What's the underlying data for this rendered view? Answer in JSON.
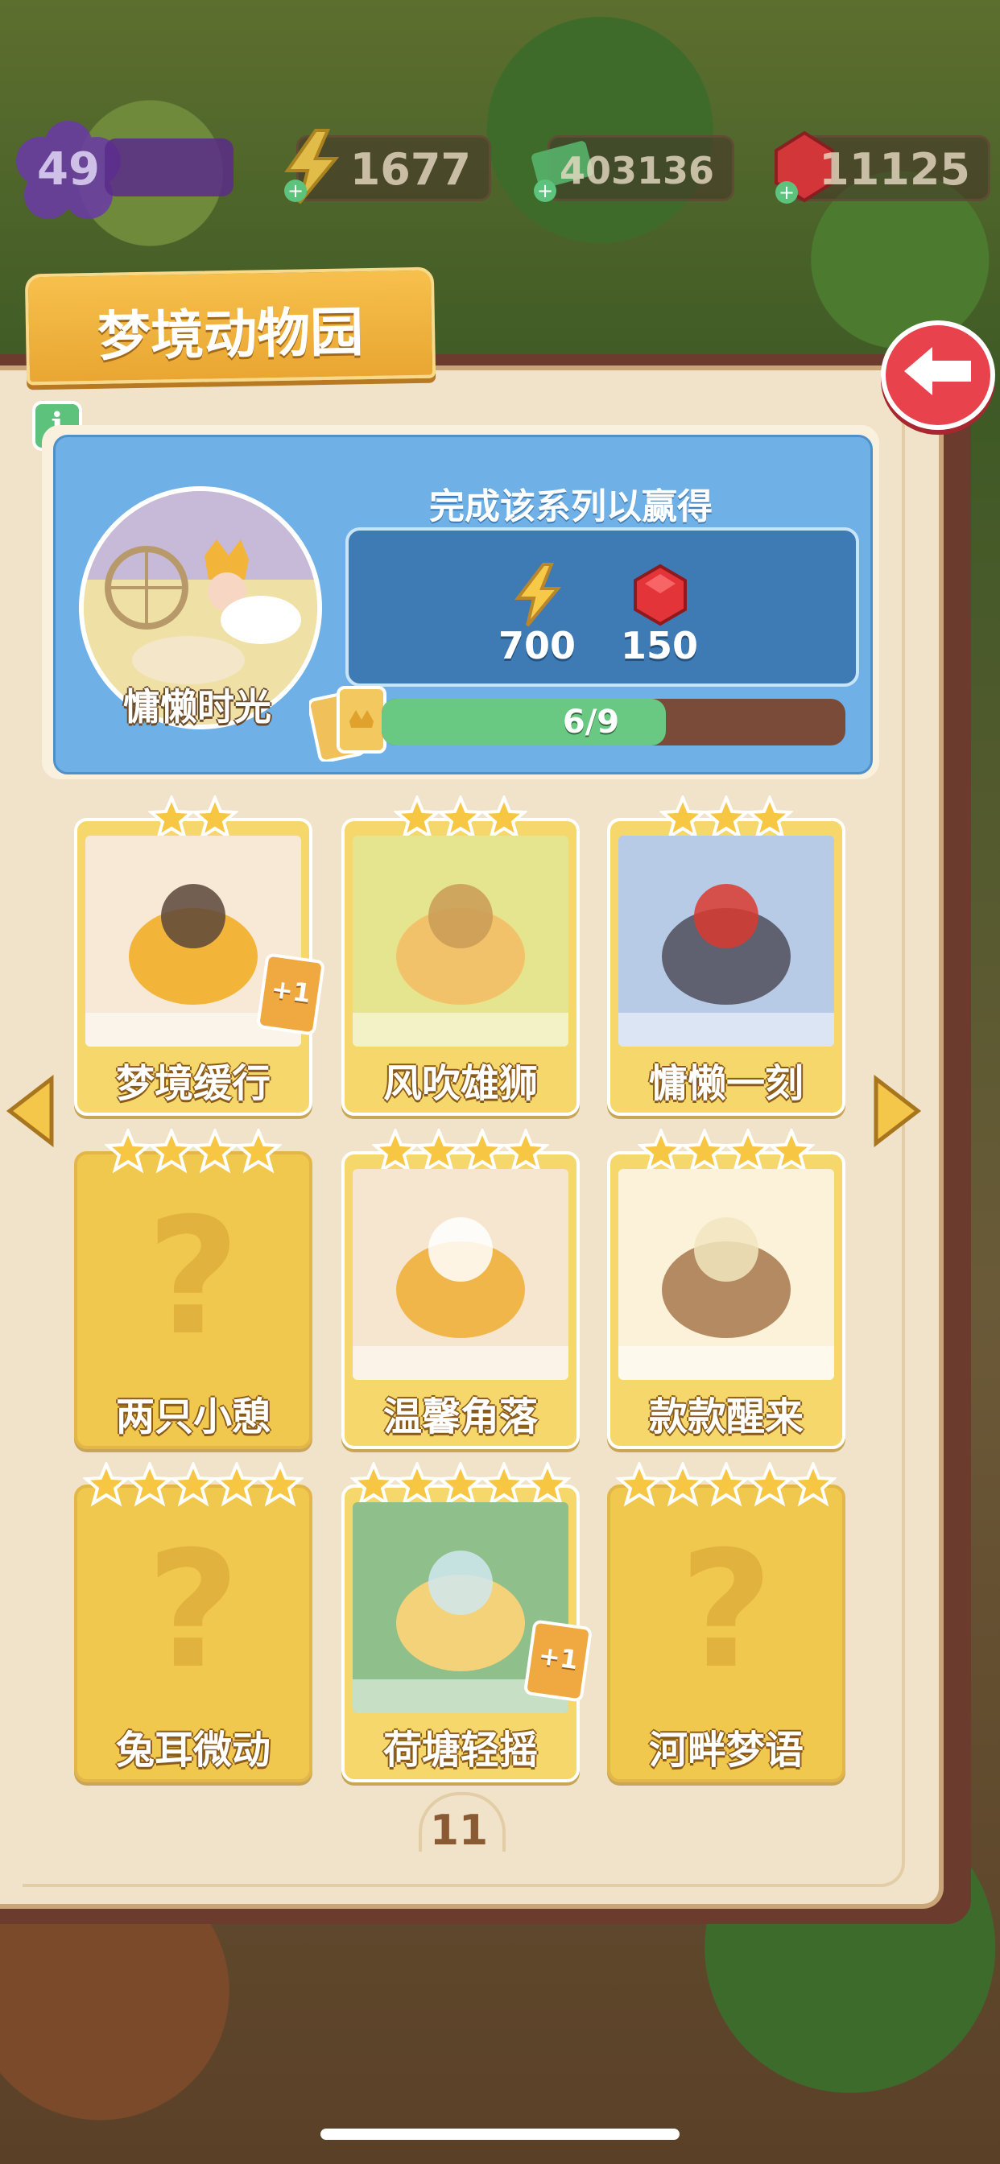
{
  "hud": {
    "level": "49",
    "energy": "1677",
    "cash": "403136",
    "gems": "11125"
  },
  "album": {
    "title": "梦境动物园",
    "reward_heading": "完成该系列以赢得",
    "rewards": [
      {
        "icon": "lightning-icon",
        "amount": "700"
      },
      {
        "icon": "ruby-icon",
        "amount": "150"
      }
    ],
    "portrait_label": "慵懒时光",
    "progress_text": "6/9",
    "progress_fraction": 0.667,
    "page_number": "11"
  },
  "cards": [
    {
      "name": "梦境缓行",
      "stars": 2,
      "unlocked": true,
      "bonus": "+1"
    },
    {
      "name": "风吹雄狮",
      "stars": 3,
      "unlocked": true,
      "bonus": ""
    },
    {
      "name": "慵懒一刻",
      "stars": 3,
      "unlocked": true,
      "bonus": ""
    },
    {
      "name": "两只小憩",
      "stars": 4,
      "unlocked": false,
      "bonus": ""
    },
    {
      "name": "温馨角落",
      "stars": 4,
      "unlocked": true,
      "bonus": ""
    },
    {
      "name": "款款醒来",
      "stars": 4,
      "unlocked": true,
      "bonus": ""
    },
    {
      "name": "兔耳微动",
      "stars": 5,
      "unlocked": false,
      "bonus": ""
    },
    {
      "name": "荷塘轻摇",
      "stars": 5,
      "unlocked": true,
      "bonus": "+1"
    },
    {
      "name": "河畔梦语",
      "stars": 5,
      "unlocked": false,
      "bonus": ""
    }
  ],
  "locked_symbol": "?",
  "colors": {
    "accent_orange": "#f7c04c",
    "back_button": "#e8424d",
    "panel_blue": "#6fb0e6",
    "progress_green": "#69c982",
    "card_yellow": "#f5d76b"
  }
}
